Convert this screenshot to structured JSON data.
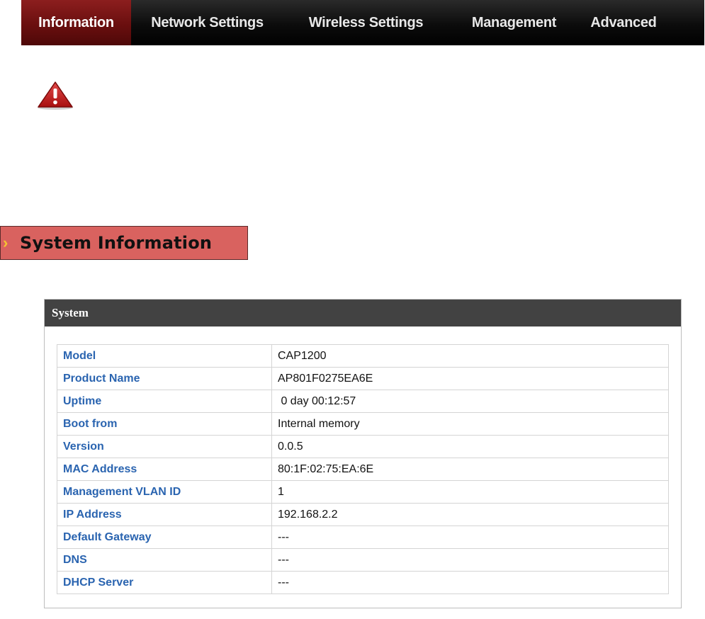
{
  "nav": {
    "items": [
      {
        "label": "Information",
        "active": true
      },
      {
        "label": "Network Settings",
        "active": false
      },
      {
        "label": "Wireless Settings",
        "active": false
      },
      {
        "label": "Management",
        "active": false
      },
      {
        "label": "Advanced",
        "active": false
      }
    ]
  },
  "warning_icon": {
    "name": "warning-triangle-icon",
    "color": "#c81e1e"
  },
  "section": {
    "title": "System Information",
    "arrow_icon": "chevron-right-icon",
    "accent": "#d9625f"
  },
  "panel": {
    "title": "System",
    "rows": [
      {
        "label": "Model",
        "value": "CAP1200"
      },
      {
        "label": "Product Name",
        "value": "AP801F0275EA6E"
      },
      {
        "label": "Uptime",
        "value": " 0 day 00:12:57"
      },
      {
        "label": "Boot from",
        "value": "Internal memory"
      },
      {
        "label": "Version",
        "value": "0.0.5"
      },
      {
        "label": "MAC Address",
        "value": "80:1F:02:75:EA:6E"
      },
      {
        "label": "Management VLAN ID",
        "value": "1"
      },
      {
        "label": "IP Address",
        "value": "192.168.2.2"
      },
      {
        "label": "Default Gateway",
        "value": "---"
      },
      {
        "label": "DNS",
        "value": "---"
      },
      {
        "label": "DHCP Server",
        "value": "---"
      }
    ]
  }
}
